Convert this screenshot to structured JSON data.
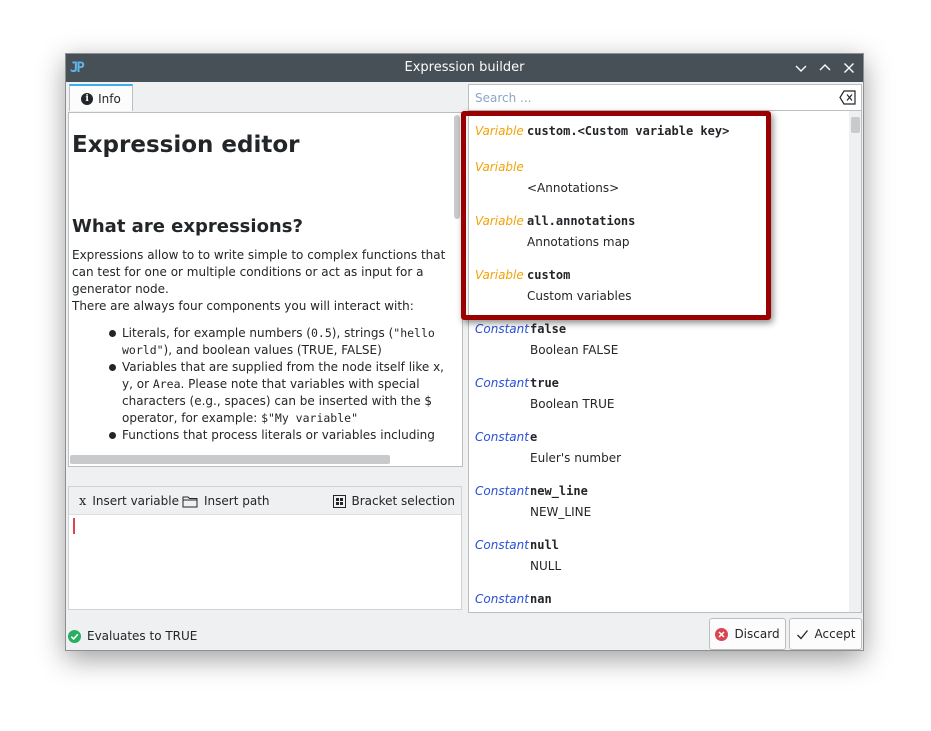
{
  "window": {
    "title": "Expression builder",
    "logo_text": "JP"
  },
  "tabs": [
    {
      "label": "Info"
    }
  ],
  "doc": {
    "heading": "Expression editor",
    "subheading": "What are expressions?",
    "para1": "Expressions allow to to write simple to complex functions that can test for one or multiple conditions or act as input for a generator node.",
    "para2": "There are always four components you will interact with:",
    "bullet1_a": "Literals, for example numbers (",
    "bullet1_code1": "0.5",
    "bullet1_b": "), strings (",
    "bullet1_code2": "\"hello world\"",
    "bullet1_c": "), and boolean values (TRUE, FALSE)",
    "bullet2_a": "Variables that are supplied from the node itself like x, y, or ",
    "bullet2_code1": "Area",
    "bullet2_b": ". Please note that variables with special characters (e.g., spaces) can be inserted with the $ operator, for example: ",
    "bullet2_code2": "$\"My variable\"",
    "bullet3": "Functions that process literals or variables including"
  },
  "editor_toolbar": {
    "insert_variable": "Insert variable",
    "insert_variable_icon": "x",
    "insert_path": "Insert path",
    "bracket_selection": "Bracket selection"
  },
  "status": {
    "text": "Evaluates to TRUE"
  },
  "buttons": {
    "discard": "Discard",
    "accept": "Accept"
  },
  "search": {
    "placeholder": "Search ..."
  },
  "items": [
    {
      "kind": "Variable",
      "name": "custom.<Custom variable key>",
      "desc": ""
    },
    {
      "kind": "Variable",
      "name": "",
      "desc": "<Annotations>"
    },
    {
      "kind": "Variable",
      "name": "all.annotations",
      "desc": "Annotations map"
    },
    {
      "kind": "Variable",
      "name": "custom",
      "desc": "Custom variables"
    },
    {
      "kind": "Constant",
      "name": "false",
      "desc": "Boolean FALSE"
    },
    {
      "kind": "Constant",
      "name": "true",
      "desc": "Boolean TRUE"
    },
    {
      "kind": "Constant",
      "name": "e",
      "desc": "Euler's number"
    },
    {
      "kind": "Constant",
      "name": "new_line",
      "desc": "NEW_LINE"
    },
    {
      "kind": "Constant",
      "name": "null",
      "desc": "NULL"
    },
    {
      "kind": "Constant",
      "name": "nan",
      "desc": ""
    }
  ],
  "colors": {
    "variable_kind": "#f0a30a",
    "constant_kind": "#2a4fd8",
    "highlight_border": "#9b0000",
    "titlebar": "#475057",
    "ok_green": "#27ae60",
    "discard_red": "#da4453"
  }
}
